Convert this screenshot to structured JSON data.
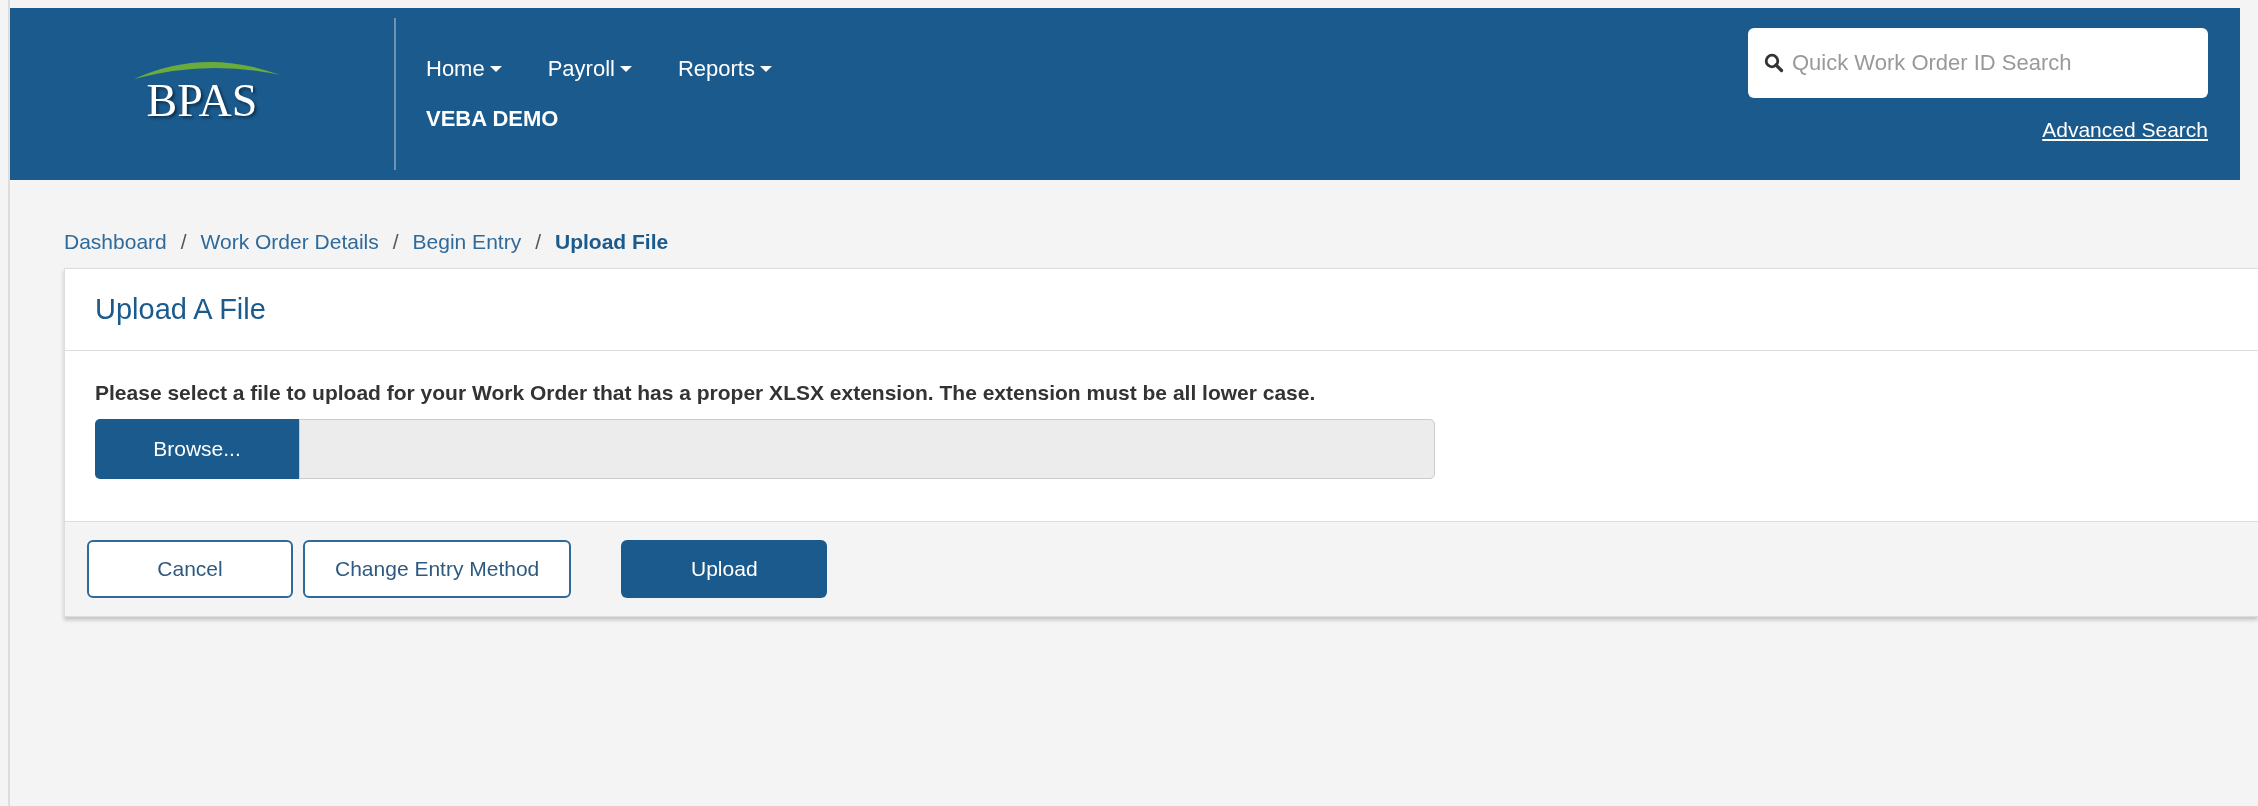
{
  "header": {
    "logo": "BPAS",
    "nav": [
      {
        "label": "Home",
        "caret": true
      },
      {
        "label": "Payroll",
        "caret": true
      },
      {
        "label": "Reports",
        "caret": true
      }
    ],
    "subtitle": "VEBA DEMO",
    "search": {
      "placeholder": "Quick Work Order ID Search"
    },
    "advanced_link": "Advanced Search"
  },
  "breadcrumb": [
    {
      "label": "Dashboard",
      "current": false
    },
    {
      "label": "Work Order Details",
      "current": false
    },
    {
      "label": "Begin Entry",
      "current": false
    },
    {
      "label": "Upload File",
      "current": true
    }
  ],
  "breadcrumb_separator": "/",
  "card": {
    "title": "Upload A File",
    "instruction": "Please select a file to upload for your Work Order that has a proper XLSX extension. The extension must be all lower case.",
    "file_input": {
      "button": "Browse..."
    },
    "buttons": [
      {
        "label": "Cancel",
        "kind": "outline"
      },
      {
        "label": "Change Entry Method",
        "kind": "outline"
      },
      {
        "label": "Upload",
        "kind": "primary"
      }
    ]
  }
}
